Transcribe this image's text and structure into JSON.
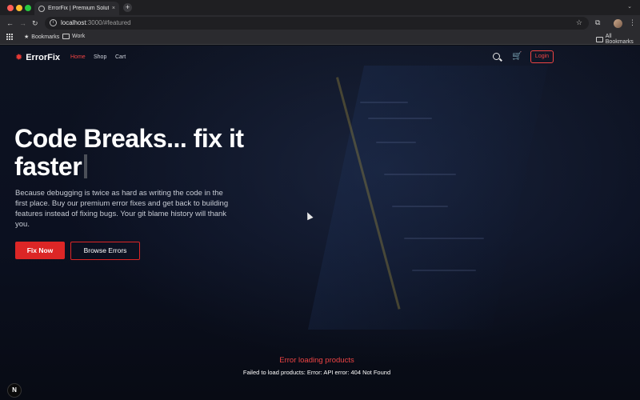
{
  "browser": {
    "tab_title": "ErrorFix | Premium Solutions",
    "tab_close": "×",
    "new_tab": "+",
    "url_host": "localhost",
    "url_rest": ":3000/#featured",
    "bookmarks": [
      "Bookmarks",
      "Work"
    ],
    "all_bookmarks": "All Bookmarks"
  },
  "nav": {
    "logo_text": "ErrorFix",
    "links": [
      "Home",
      "Shop",
      "Cart"
    ],
    "login": "Login"
  },
  "hero": {
    "title": "Code Breaks... fix it faster",
    "description": "Because debugging is twice as hard as writing the code in the first place. Buy our premium error fixes and get back to building features instead of fixing bugs. Your git blame history will thank you.",
    "primary_button": "Fix Now",
    "secondary_button": "Browse Errors"
  },
  "products": {
    "error_title": "Error loading products",
    "error_message": "Failed to load products: Error: API error: 404 Not Found"
  },
  "badge": {
    "label": "N"
  },
  "colors": {
    "accent": "#ef4444",
    "button_red": "#dc2626",
    "page_bg": "#0b1020"
  }
}
